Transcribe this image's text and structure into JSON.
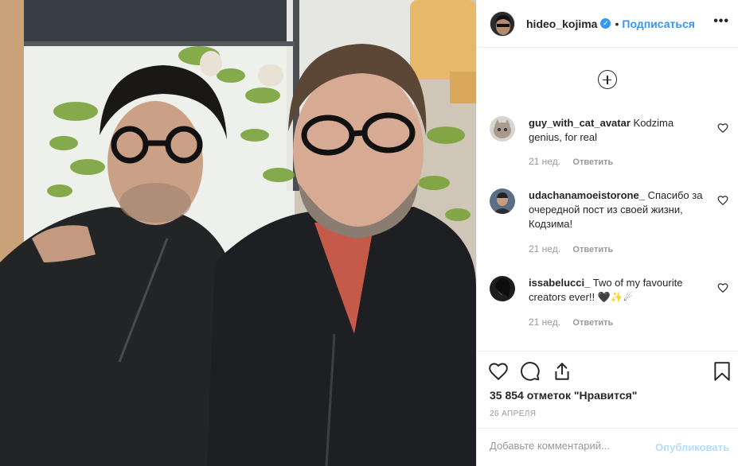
{
  "header": {
    "username": "hideo_kojima",
    "verified_icon": "verified-badge-icon",
    "separator": "•",
    "follow_label": "Подписаться",
    "more_label": "•••"
  },
  "load_more_icon": "plus-circle-icon",
  "comments": [
    {
      "username": "guy_with_cat_avatar",
      "text": "Kodzima genius, for real",
      "time": "21 нед.",
      "reply_label": "Ответить"
    },
    {
      "username": "udachanamoeistorone_",
      "text": "Спасибо за очередной пост из своей жизни, Кодзима!",
      "time": "21 нед.",
      "reply_label": "Ответить"
    },
    {
      "username": "issabelucci_",
      "text": "Two of my favourite creators ever!! 🖤✨☄",
      "time": "21 нед.",
      "reply_label": "Ответить"
    }
  ],
  "actions": {
    "icons": [
      "heart-icon",
      "comment-icon",
      "share-icon",
      "bookmark-icon"
    ],
    "likes_text": "35 854 отметок \"Нравится\"",
    "date_text": "26 АПРЕЛЯ"
  },
  "add_comment": {
    "placeholder": "Добавьте комментарий...",
    "publish_label": "Опубликовать"
  },
  "colors": {
    "accent": "#3897f0",
    "publish_disabled": "#b2dffc",
    "muted": "#999999",
    "text": "#262626"
  }
}
